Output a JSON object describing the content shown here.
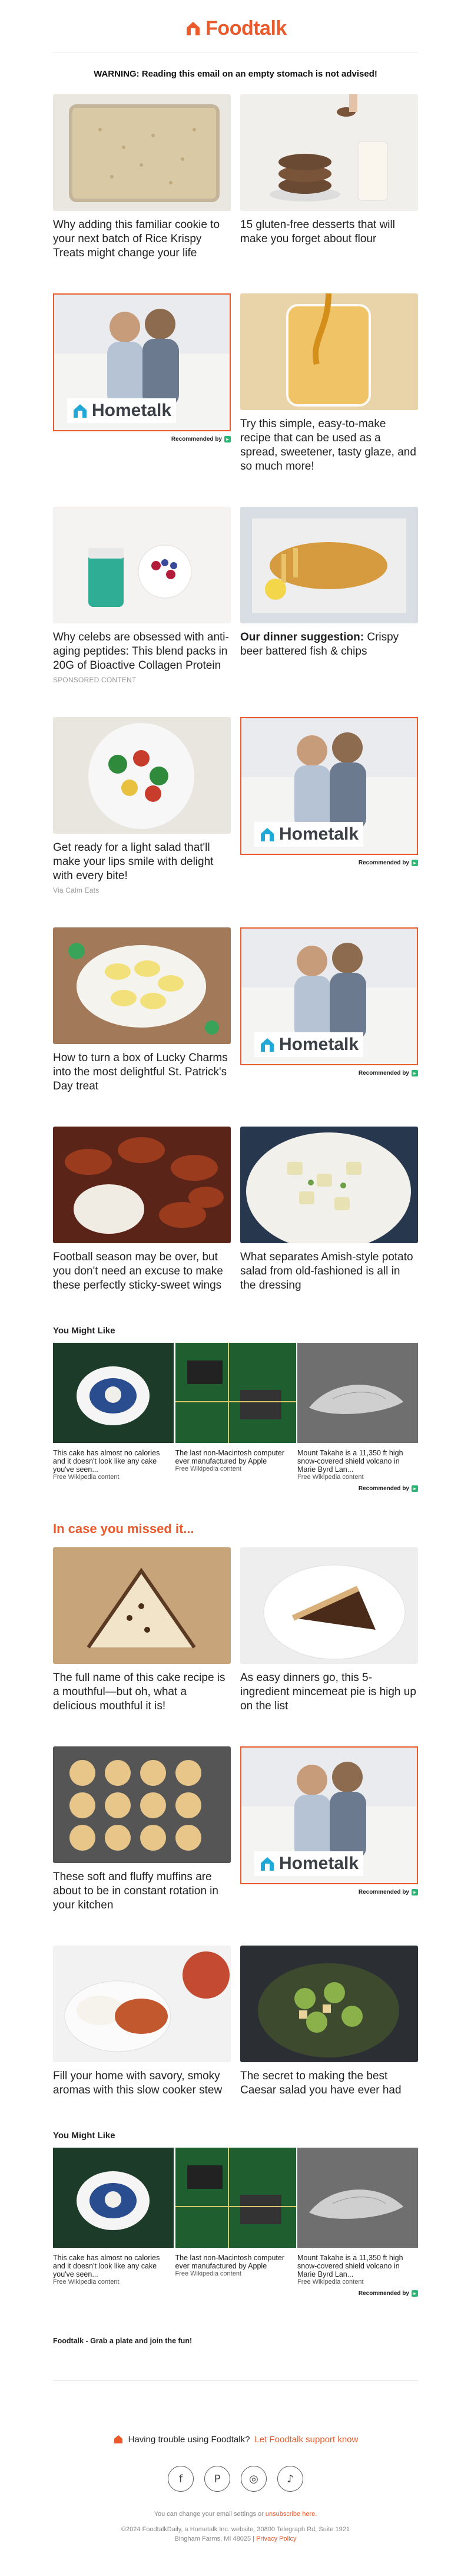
{
  "brand": {
    "name": "Foodtalk",
    "accent": "#ea5a2b"
  },
  "warning": "WARNING: Reading this email on an empty stomach is not advised!",
  "rows": [
    {
      "left": {
        "kind": "article",
        "title": "Why adding this familiar cookie to your next batch of Rice Krispy Treats might change your life",
        "sub": ""
      },
      "right": {
        "kind": "article",
        "title": "15 gluten-free desserts that will make you forget about flour",
        "sub": ""
      }
    },
    {
      "left": {
        "kind": "ad"
      },
      "right": {
        "kind": "article",
        "title": "Try this simple, easy-to-make recipe that can be used as a spread, sweetener, tasty glaze, and so much more!",
        "sub": ""
      }
    },
    {
      "left": {
        "kind": "article",
        "title": "Why celebs are obsessed with anti-aging peptides: This blend packs in 20G of Bioactive Collagen Protein",
        "sub": "SPONSORED CONTENT"
      },
      "right": {
        "kind": "article",
        "bold_prefix": "Our dinner suggestion:",
        "title": " Crispy beer battered fish & chips",
        "sub": ""
      }
    },
    {
      "left": {
        "kind": "article",
        "title": "Get ready for a light salad that'll make your lips smile with delight with every bite!",
        "sub": "Via Calm Eats"
      },
      "right": {
        "kind": "ad"
      }
    },
    {
      "left": {
        "kind": "article",
        "title": "How to turn a box of Lucky Charms into the most delightful St. Patrick's Day treat",
        "sub": ""
      },
      "right": {
        "kind": "ad"
      }
    },
    {
      "left": {
        "kind": "article",
        "title": "Football season may be over, but you don't need an excuse to make these perfectly sticky-sweet wings",
        "sub": ""
      },
      "right": {
        "kind": "article",
        "title": "What separates Amish-style potato salad from old-fashioned is all in the dressing",
        "sub": ""
      }
    }
  ],
  "ad": {
    "brand": "Hometalk",
    "recommended": "Recommended by"
  },
  "you_might_like": {
    "heading": "You Might Like",
    "items": [
      {
        "title": "This cake has almost no calories and it doesn't look like any cake you've seen...",
        "source": "Free Wikipedia content"
      },
      {
        "title": "The last non-Macintosh computer ever manufactured by Apple",
        "source": "Free Wikipedia content"
      },
      {
        "title": "Mount Takahe is a 11,350 ft high snow-covered shield volcano in Marie Byrd Lan...",
        "source": "Free Wikipedia content"
      }
    ]
  },
  "missed": {
    "heading": "In case you missed it...",
    "rows": [
      {
        "left": {
          "kind": "article",
          "title": "The full name of this cake recipe is a mouthful—but oh, what a delicious mouthful it is!"
        },
        "right": {
          "kind": "article",
          "title": "As easy dinners go, this 5-ingredient mincemeat pie is high up on the list"
        }
      },
      {
        "left": {
          "kind": "article",
          "title": "These soft and fluffy muffins are about to be in constant rotation in your kitchen"
        },
        "right": {
          "kind": "ad"
        }
      },
      {
        "left": {
          "kind": "article",
          "title": "Fill your home with savory, smoky aromas with this slow cooker stew"
        },
        "right": {
          "kind": "article",
          "title": "The secret to making the best Caesar salad you have ever had"
        }
      }
    ]
  },
  "footer": {
    "tagline": "Foodtalk - Grab a plate and join the fun!",
    "help_text": "Having trouble using Foodtalk?",
    "help_link": "Let Foodtalk support know",
    "settings_text": "You can change your email settings or",
    "unsubscribe": "unsubscribe here.",
    "legal_line1": "©2024 FoodtalkDaily, a Hometalk Inc. website, 30800 Telegraph Rd, Suite 1921",
    "legal_line2": "Bingham Farms, MI 48025 |",
    "privacy": "Privacy Policy",
    "social_icons": [
      "facebook-icon",
      "pinterest-icon",
      "instagram-icon",
      "tiktok-icon"
    ]
  }
}
